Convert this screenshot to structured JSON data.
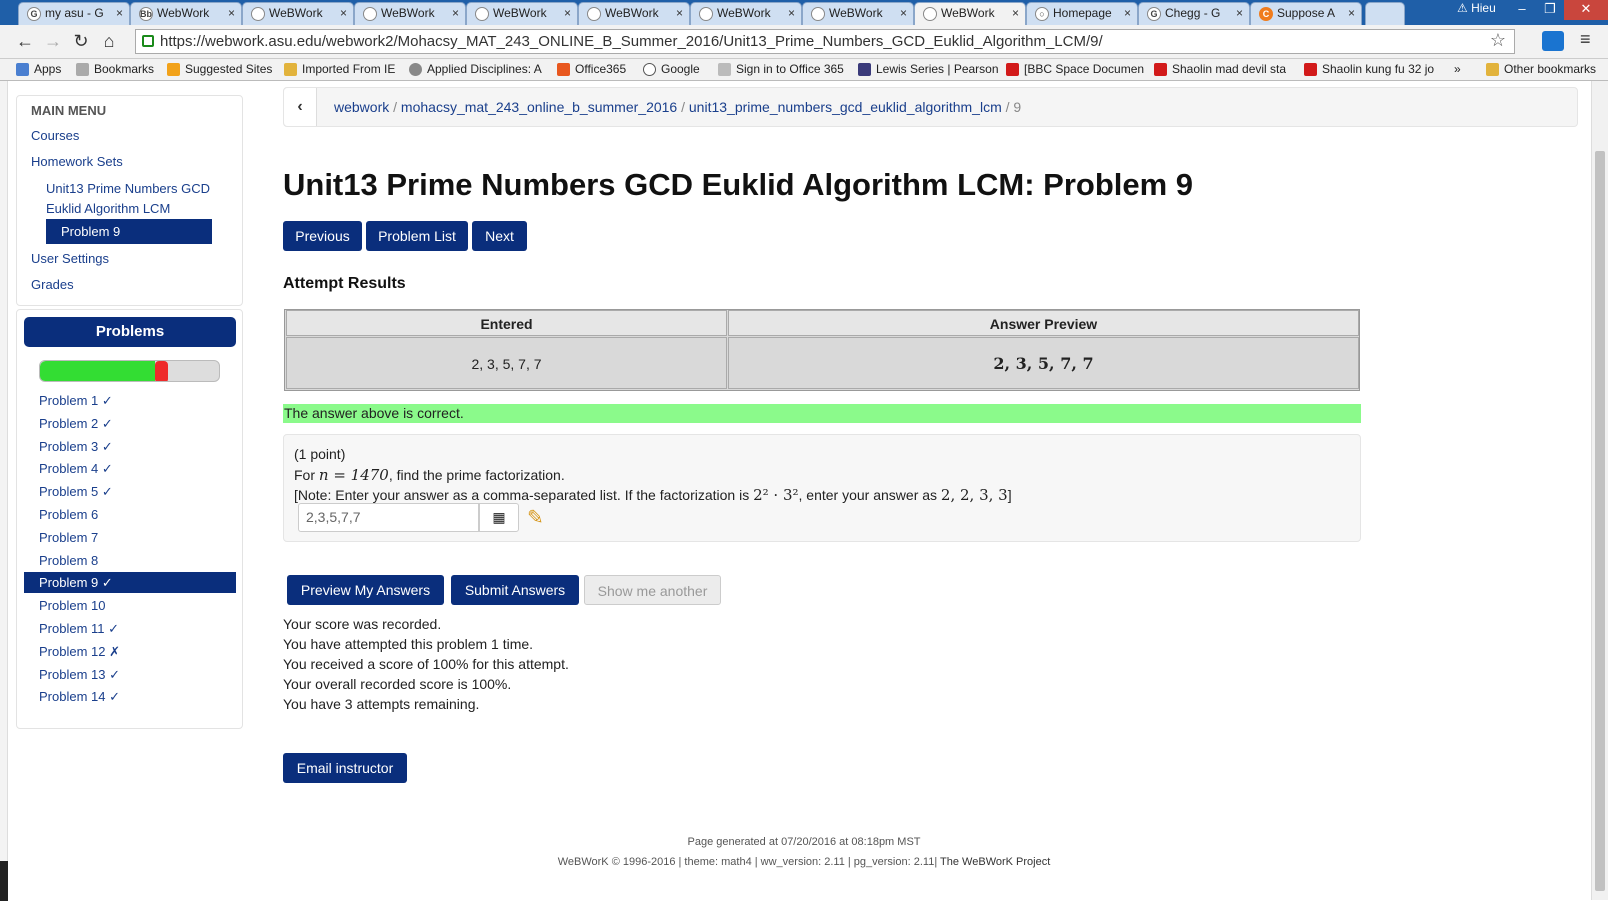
{
  "browser": {
    "tabs": [
      {
        "label": "my asu - G",
        "icon": "G",
        "active": false
      },
      {
        "label": "WebWork",
        "icon": "Bb",
        "active": false
      },
      {
        "label": "WeBWork",
        "icon": "",
        "active": false
      },
      {
        "label": "WeBWork",
        "icon": "",
        "active": false
      },
      {
        "label": "WeBWork",
        "icon": "",
        "active": false
      },
      {
        "label": "WeBWork",
        "icon": "",
        "active": false
      },
      {
        "label": "WeBWork",
        "icon": "",
        "active": false
      },
      {
        "label": "WeBWork",
        "icon": "",
        "active": false
      },
      {
        "label": "WeBWork",
        "icon": "",
        "active": true
      },
      {
        "label": "Homepage",
        "icon": "search",
        "active": false
      },
      {
        "label": "Chegg - G",
        "icon": "G",
        "active": false
      },
      {
        "label": "Suppose A",
        "icon": "C",
        "active": false
      }
    ],
    "user_label": "Hieu",
    "url": "https://webwork.asu.edu/webwork2/Mohacsy_MAT_243_ONLINE_B_Summer_2016/Unit13_Prime_Numbers_GCD_Euklid_Algorithm_LCM/9/",
    "bookmarks": [
      {
        "label": "Apps"
      },
      {
        "label": "Bookmarks"
      },
      {
        "label": "Suggested Sites"
      },
      {
        "label": "Imported From IE"
      },
      {
        "label": "Applied Disciplines: A"
      },
      {
        "label": "Office365"
      },
      {
        "label": "Google"
      },
      {
        "label": "Sign in to Office 365"
      },
      {
        "label": "Lewis Series | Pearson"
      },
      {
        "label": "[BBC Space Documen"
      },
      {
        "label": "Shaolin mad devil sta"
      },
      {
        "label": "Shaolin kung fu 32 jo"
      },
      {
        "label": "Other bookmarks"
      }
    ]
  },
  "sidebar": {
    "main_menu_title": "MAIN MENU",
    "courses": "Courses",
    "homework_sets": "Homework Sets",
    "current_set": "Unit13 Prime Numbers GCD Euklid Algorithm LCM",
    "current_problem": "Problem 9",
    "user_settings": "User Settings",
    "grades": "Grades"
  },
  "problems_panel": {
    "title": "Problems",
    "progress": {
      "correct_fraction": 0.64,
      "incorrect_fraction": 0.07
    },
    "items": [
      {
        "label": "Problem 1 ✓",
        "active": false
      },
      {
        "label": "Problem 2 ✓",
        "active": false
      },
      {
        "label": "Problem 3 ✓",
        "active": false
      },
      {
        "label": "Problem 4 ✓",
        "active": false
      },
      {
        "label": "Problem 5 ✓",
        "active": false
      },
      {
        "label": "Problem 6",
        "active": false
      },
      {
        "label": "Problem 7",
        "active": false
      },
      {
        "label": "Problem 8",
        "active": false
      },
      {
        "label": "Problem 9 ✓",
        "active": true
      },
      {
        "label": "Problem 10",
        "active": false
      },
      {
        "label": "Problem 11 ✓",
        "active": false
      },
      {
        "label": "Problem 12 ✗",
        "active": false
      },
      {
        "label": "Problem 13 ✓",
        "active": false
      },
      {
        "label": "Problem 14 ✓",
        "active": false
      }
    ]
  },
  "breadcrumb": {
    "back_icon": "chevron-left-icon",
    "parts": [
      "webwork",
      "mohacsy_mat_243_online_b_summer_2016",
      "unit13_prime_numbers_gcd_euklid_algorithm_lcm"
    ],
    "current": "9",
    "separator": "/"
  },
  "main": {
    "title": "Unit13 Prime Numbers GCD Euklid Algorithm LCM: Problem 9",
    "nav_buttons": {
      "previous": "Previous",
      "problem_list": "Problem List",
      "next": "Next"
    },
    "attempt_results_title": "Attempt Results",
    "results_table": {
      "headers": [
        "Entered",
        "Answer Preview"
      ],
      "entered": "2, 3, 5, 7, 7",
      "preview": "2, 3, 5, 7, 7"
    },
    "correct_message": "The answer above is correct.",
    "problem": {
      "points": "(1 point)",
      "line1_pre": "For",
      "line1_math": "n = 1470",
      "line1_post": ", find the prime factorization.",
      "line2_pre": "[Note: Enter your answer as a comma-separated list. If the factorization is",
      "line2_math": "2² · 3²",
      "line2_mid": ", enter your answer as",
      "line2_math2": "2, 2, 3, 3",
      "line2_post": "]",
      "answer_value": "2,3,5,7,7"
    },
    "action_buttons": {
      "preview": "Preview My Answers",
      "submit": "Submit Answers",
      "show_another": "Show me another"
    },
    "score_messages": [
      "Your score was recorded.",
      "You have attempted this problem 1 time.",
      "You received a score of 100% for this attempt.",
      "Your overall recorded score is 100%.",
      "You have 3 attempts remaining."
    ],
    "email_button": "Email instructor"
  },
  "footer": {
    "generated": "Page generated at 07/20/2016 at 08:18pm MST",
    "copyright": "WeBWorK © 1996-2016 | theme: math4 | ww_version: 2.11 | pg_version: 2.11|",
    "project_link": "The WeBWorK Project"
  },
  "colors": {
    "primary": "#0a2e7c",
    "correct": "#8bfa8b",
    "chrome": "#2b6cb3"
  }
}
